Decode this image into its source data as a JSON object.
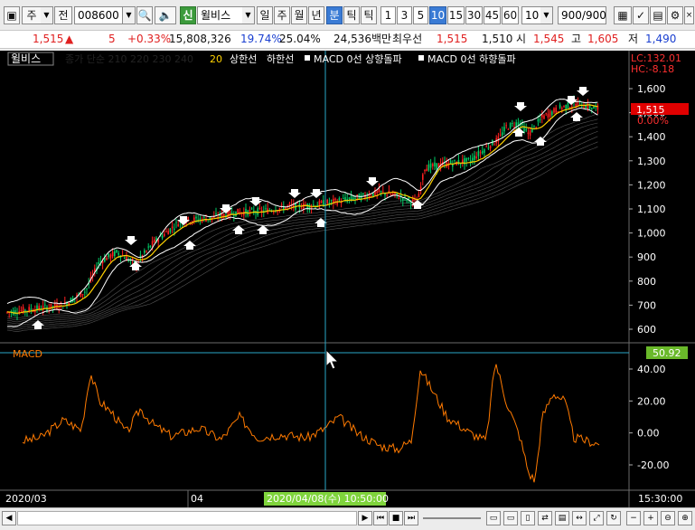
{
  "toolbar": {
    "mode": "주",
    "prev": "전",
    "code": "008600",
    "badge": "신",
    "stock_name": "윌비스",
    "period_day": "일",
    "period_week": "주",
    "period_month": "월",
    "period_year": "년",
    "period_min": "분",
    "period_tick": "틱",
    "intervals": [
      "1",
      "3",
      "5",
      "10",
      "15",
      "30",
      "45",
      "60"
    ],
    "selected_interval": "10",
    "count_select": "10",
    "view_count": "900/900"
  },
  "quote": {
    "price": "1,515",
    "change": "5",
    "change_pct": "+0.33%",
    "volume": "15,808,326",
    "rate1": "19.74%",
    "rate2": "25.04%",
    "amount": "24,536백만",
    "side": "최우선",
    "ask": "1,515",
    "bid": "1,510",
    "open_label": "시",
    "open": "1,545",
    "high_label": "고",
    "high": "1,605",
    "low_label": "저",
    "low": "1,490"
  },
  "chart": {
    "legend_name": "윌비스",
    "legend_ma": "종가 단순 210 220 230 240",
    "legend_20": "20",
    "legend_upper": "상한선",
    "legend_lower": "하한선",
    "legend_macd_up": "MACD 0선 상향돌파",
    "legend_macd_down": "MACD 0선 하향돌파",
    "lc": "LC:132.01",
    "hc": "HC:-8.18",
    "price_badge": "1,515",
    "pct_badge": "0.00%",
    "price_ticks": [
      "1,600",
      "1,500",
      "1,400",
      "1,300",
      "1,200",
      "1,100",
      "1,000",
      "900",
      "800",
      "700",
      "600"
    ],
    "macd_label": "MACD",
    "macd_badge": "50.92",
    "macd_ticks": [
      "40.00",
      "20.00",
      "0.00",
      "-20.00"
    ],
    "date_left": "2020/03",
    "date_mid": "04",
    "cursor_date": "2020/04/08(수) 10:50:00",
    "time_right": "15:30:00",
    "colors": {
      "candle_up": "#ff2020",
      "candle_down": "#00cc66",
      "ma20": "#ffd200",
      "bands": "#ffffff",
      "macd": "#ff7a00",
      "cursor": "#2aa7c7"
    }
  }
}
